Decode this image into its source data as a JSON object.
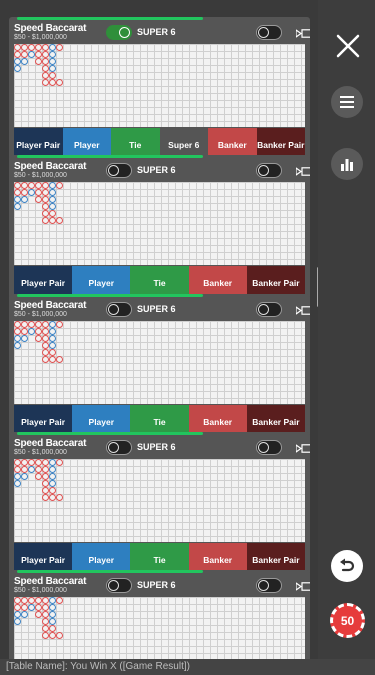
{
  "tables": [
    {
      "name": "Speed Baccarat",
      "limits": "$50 - $1,000,000",
      "super6_label": "SUPER 6",
      "super6_on": true,
      "bets": [
        {
          "label": "Player Pair",
          "kind": "pp"
        },
        {
          "label": "Player",
          "kind": "pl"
        },
        {
          "label": "Tie",
          "kind": "tie"
        },
        {
          "label": "Super 6",
          "kind": "s6"
        },
        {
          "label": "Banker",
          "kind": "bk"
        },
        {
          "label": "Banker Pair",
          "kind": "bp"
        }
      ]
    },
    {
      "name": "Speed Baccarat",
      "limits": "$50 - $1,000,000",
      "super6_label": "SUPER 6",
      "super6_on": false,
      "bets": [
        {
          "label": "Player Pair",
          "kind": "pp"
        },
        {
          "label": "Player",
          "kind": "pl"
        },
        {
          "label": "Tie",
          "kind": "tie"
        },
        {
          "label": "Banker",
          "kind": "bk"
        },
        {
          "label": "Banker Pair",
          "kind": "bp"
        }
      ]
    },
    {
      "name": "Speed Baccarat",
      "limits": "$50 - $1,000,000",
      "super6_label": "SUPER 6",
      "super6_on": false,
      "bets": [
        {
          "label": "Player Pair",
          "kind": "pp"
        },
        {
          "label": "Player",
          "kind": "pl"
        },
        {
          "label": "Tie",
          "kind": "tie"
        },
        {
          "label": "Banker",
          "kind": "bk"
        },
        {
          "label": "Banker Pair",
          "kind": "bp"
        }
      ]
    },
    {
      "name": "Speed Baccarat",
      "limits": "$50 - $1,000,000",
      "super6_label": "SUPER 6",
      "super6_on": false,
      "bets": [
        {
          "label": "Player Pair",
          "kind": "pp"
        },
        {
          "label": "Player",
          "kind": "pl"
        },
        {
          "label": "Tie",
          "kind": "tie"
        },
        {
          "label": "Banker",
          "kind": "bk"
        },
        {
          "label": "Banker Pair",
          "kind": "bp"
        }
      ]
    },
    {
      "name": "Speed Baccarat",
      "limits": "$50 - $1,000,000",
      "super6_label": "SUPER 6",
      "super6_on": false,
      "bets": []
    }
  ],
  "road": {
    "columns": [
      [
        "B",
        "B",
        "P",
        "P"
      ],
      [
        "B",
        "B",
        "P"
      ],
      [
        "B",
        "P"
      ],
      [
        "B",
        "B",
        "B"
      ],
      [
        "B",
        "B",
        "B",
        "B",
        "B",
        "B",
        "B",
        "B"
      ],
      [
        "P",
        "P",
        "P",
        "P",
        "B"
      ],
      [
        "B"
      ]
    ]
  },
  "colors": {
    "banker": "#e05050",
    "player": "#3b82c4",
    "accent": "#22c55e",
    "chip": "#e63c3c"
  },
  "sidebar": {
    "close_icon": "close-icon",
    "menu_icon": "menu-icon",
    "stats_icon": "stats-icon",
    "undo_icon": "undo-icon",
    "chip_value": "50"
  },
  "footer": {
    "text": "[Table Name]: You Win X ([Game Result])"
  }
}
